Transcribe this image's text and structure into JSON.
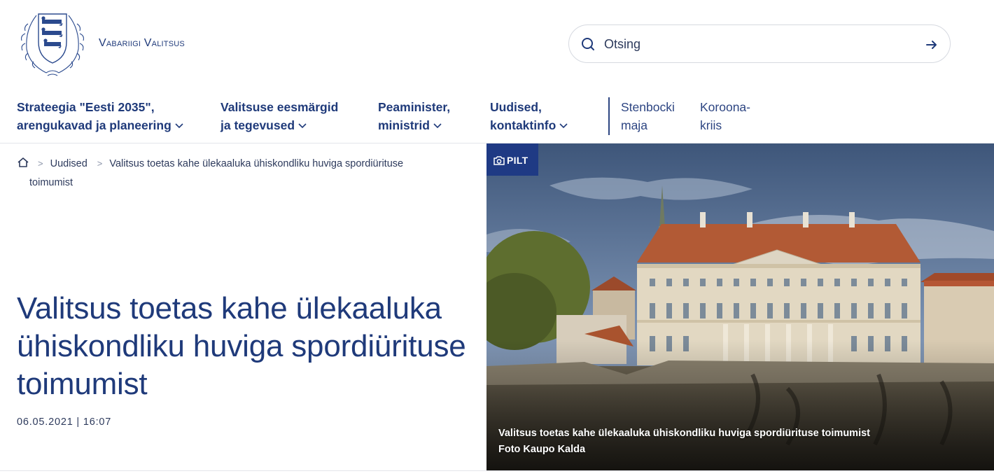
{
  "header": {
    "site_name": "Vabariigi Valitsus",
    "logo_icon": "coat-of-arms-logo"
  },
  "search": {
    "placeholder": "Otsing",
    "value": "",
    "icon": "search-icon",
    "submit_icon": "arrow-right-icon"
  },
  "nav": {
    "items": [
      {
        "line1": "Strateegia \"Eesti 2035\",",
        "line2": "arengukavad ja planeering",
        "has_dropdown": true
      },
      {
        "line1": "Valitsuse eesmärgid",
        "line2": "ja tegevused",
        "has_dropdown": true
      },
      {
        "line1": "Peaminister,",
        "line2": "ministrid",
        "has_dropdown": true
      },
      {
        "line1": "Uudised,",
        "line2": "kontaktinfo",
        "has_dropdown": true
      }
    ],
    "secondary": [
      {
        "line1": "Stenbocki",
        "line2": "maja"
      },
      {
        "line1": "Koroona-",
        "line2": "kriis"
      }
    ]
  },
  "breadcrumb": {
    "home_icon": "home-icon",
    "section": "Uudised",
    "current_line1": "Valitsus toetas kahe ülekaaluka ühiskondliku huviga spordiürituse",
    "current_line2": "toimumist"
  },
  "article": {
    "title": "Valitsus toetas kahe ülekaaluka ühiskondliku huviga spordiürituse toimumist",
    "date": "06.05.2021",
    "time_separator": "|",
    "time": "16:07"
  },
  "photo": {
    "badge_label": "PILT",
    "badge_icon": "camera-icon",
    "caption_line1": "Valitsus toetas kahe ülekaaluka ühiskondliku huviga spordiürituse toimumist",
    "caption_line2": "Foto Kaupo Kalda"
  },
  "colors": {
    "brand_blue": "#1f3a7a",
    "badge_blue": "#1f3a84",
    "text": "#2d3a5c",
    "border": "#d6d9e0"
  }
}
